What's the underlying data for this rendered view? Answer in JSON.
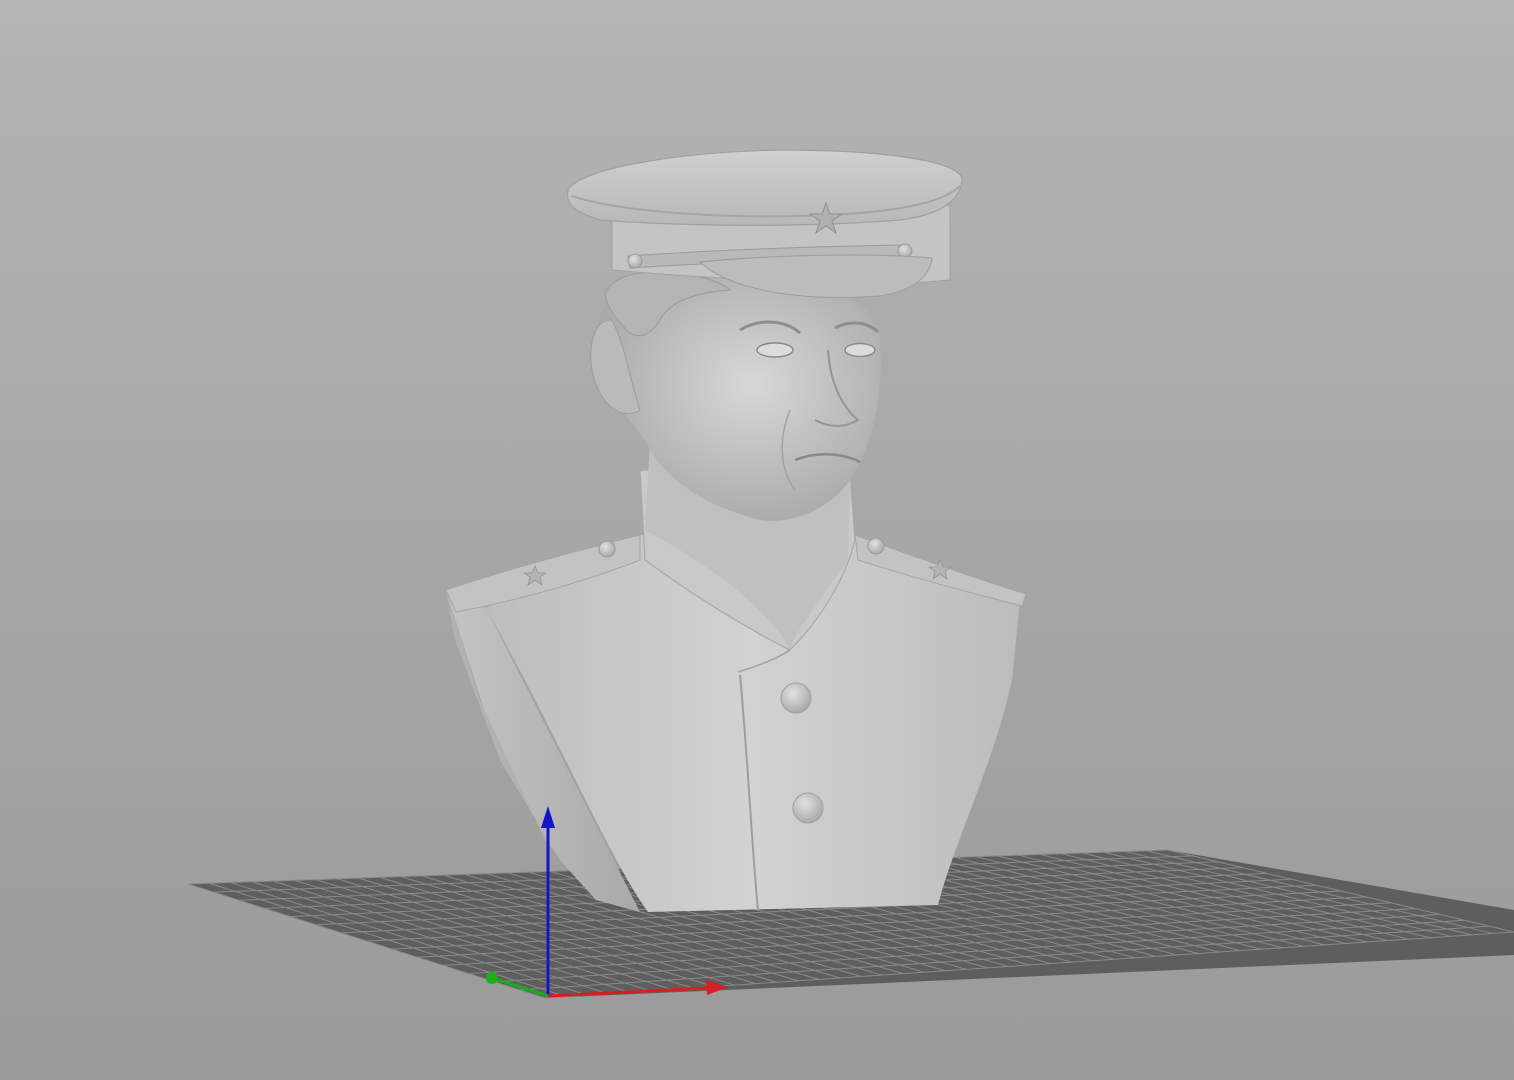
{
  "viewport": {
    "background_top": "#b4b4b4",
    "background_bottom": "#9a9a9a",
    "model_color": "#c8c8c8",
    "grid_fill": "#5e5e5e",
    "grid_line": "#8a8a8a"
  },
  "axes": {
    "x_color": "#d42020",
    "y_color": "#18b018",
    "z_color": "#1414c8"
  },
  "model": {
    "kind": "bust",
    "icons": [
      "cap-star-icon",
      "epaulette-star-left-icon",
      "epaulette-star-right-icon"
    ]
  }
}
